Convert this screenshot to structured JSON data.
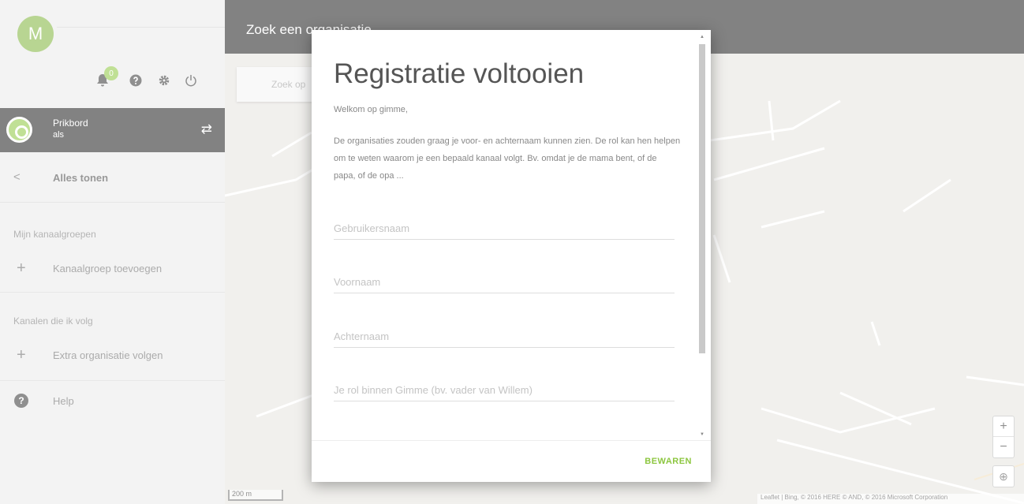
{
  "sidebar": {
    "avatar_initial": "M",
    "notification_count": "0",
    "board": {
      "title": "Prikbord",
      "subtitle": "als"
    },
    "back_label": "Alles tonen",
    "section_groups": "Mijn kanaalgroepen",
    "add_group_label": "Kanaalgroep toevoegen",
    "section_channels": "Kanalen die ik volg",
    "follow_org_label": "Extra organisatie volgen",
    "help_label": "Help"
  },
  "header": {
    "title": "Zoek een organisatie"
  },
  "search": {
    "placeholder": "Zoek op"
  },
  "map": {
    "scale": "200 m",
    "attribution": "Leaflet | Bing, © 2016 HERE © AND, © 2016 Microsoft Corporation"
  },
  "modal": {
    "title": "Registratie voltooien",
    "welcome": "Welkom op gimme,",
    "intro": "De organisaties zouden graag je voor- en achternaam kunnen zien. De rol kan hen helpen om te weten waarom je een bepaald kanaal volgt. Bv. omdat je de mama bent, of de papa, of de opa ...",
    "fields": {
      "username": "Gebruikersnaam",
      "firstname": "Voornaam",
      "lastname": "Achternaam",
      "role": "Je rol binnen Gimme (bv. vader van Willem)"
    },
    "save_label": "BEWAREN"
  },
  "colors": {
    "accent": "#8cc63f",
    "dark": "#1c1c1c"
  }
}
